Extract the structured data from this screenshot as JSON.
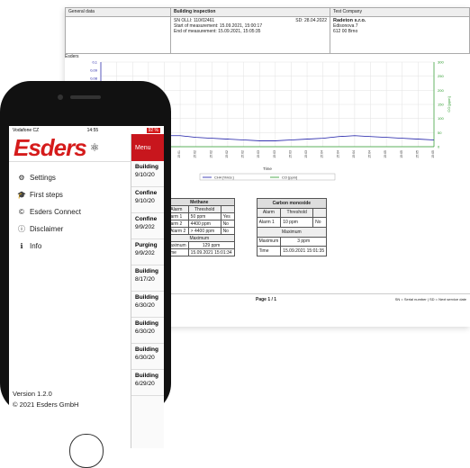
{
  "report": {
    "general_label": "General data",
    "title": "Building inspection",
    "sn": "SN OLLI: 110/02461",
    "sd": "SD: 28.04.2022",
    "start": "Start of measurement: 15.09.2021, 15:00:17",
    "end": "End of measurement: 15.09.2021, 15:05:35",
    "company_label": "Test Company",
    "company_name": "Radeton s.r.o.",
    "company_street": "Edisonova 7",
    "company_city": "612 00 Brno",
    "brand": "Esders",
    "time_label": "Time",
    "legend_ch4": "CH4 [%Vol.]",
    "legend_co": "CO [ppm]",
    "page": "Page 1 / 1",
    "footer_legend": "SN = Serial number  |  SD = Next service date",
    "methane": {
      "caption": "Methane",
      "h_alarm": "Alarm",
      "h_threshold": "Threshold",
      "a1": "Alarm 1",
      "a1v": "50 ppm",
      "a1s": "Yes",
      "a2": "Alarm 2",
      "a2v": "4400 ppm",
      "a2s": "No",
      "a3": "> Alarm 2",
      "a3v": "> 4400 ppm",
      "a3s": "No",
      "maxhdr": "Maximum",
      "max": "Maximum",
      "maxv": "129 ppm",
      "time": "Time",
      "timev": "15.09.2021 15:01:34"
    },
    "co": {
      "caption": "Carbon monoxide",
      "h_alarm": "Alarm",
      "h_threshold": "Threshold",
      "a1": "Alarm 1",
      "a1v": "10 ppm",
      "a1s": "No",
      "maxhdr": "Maximum",
      "max": "Maximum",
      "maxv": "3 ppm",
      "time": "Time",
      "timev": "15.09.2021 15:01:35"
    }
  },
  "chart_data": {
    "type": "line",
    "x": [
      "15:00",
      "15:00",
      "15:01",
      "15:01",
      "15:01",
      "15:01",
      "15:02",
      "15:02",
      "15:02",
      "15:02",
      "15:03",
      "15:03",
      "15:03",
      "15:03",
      "15:04",
      "15:04",
      "15:04",
      "15:04",
      "15:05",
      "15:05",
      "15:05",
      "15:05"
    ],
    "left_ticks": [
      "0,1",
      "0,09",
      "0,08",
      "0,07"
    ],
    "right_ticks": [
      "300",
      "250",
      "200",
      "150",
      "100",
      "50",
      "0"
    ],
    "right_label": "CO [ppm]",
    "xlabel": "Time",
    "ylim_left": [
      0,
      0.1
    ],
    "ylim_right": [
      0,
      300
    ],
    "series": [
      {
        "name": "CH4 [%Vol.]",
        "color": "#1a1aa6",
        "values": [
          0.011,
          0.011,
          0.011,
          0.012,
          0.013,
          0.013,
          0.011,
          0.01,
          0.009,
          0.008,
          0.007,
          0.007,
          0.008,
          0.009,
          0.01,
          0.012,
          0.013,
          0.012,
          0.011,
          0.01,
          0.009,
          0.008
        ]
      },
      {
        "name": "CO [ppm]",
        "color": "#2a9a2a",
        "values": [
          0,
          0,
          0,
          0,
          0,
          0,
          0,
          0,
          0,
          0,
          0,
          0,
          0,
          0,
          0,
          0,
          0,
          0,
          0,
          0,
          0,
          0
        ]
      }
    ],
    "grid": true,
    "legend": "bottom"
  },
  "phone": {
    "carrier": "Vodafone CZ",
    "time": "14:55",
    "battery": "92 %",
    "logo": "Esders",
    "menu_button": "Menu",
    "items": [
      {
        "label": "Settings",
        "icon": "⚙"
      },
      {
        "label": "First steps",
        "icon": "🎓"
      },
      {
        "label": "Esders Connect",
        "icon": "©"
      },
      {
        "label": "Disclaimer",
        "icon": "ⓘ"
      },
      {
        "label": "Info",
        "icon": "ℹ"
      }
    ],
    "version": "Version 1.2.0",
    "copyright": "© 2021 Esders GmbH",
    "jobs": [
      {
        "title": "Building",
        "date": "9/10/20"
      },
      {
        "title": "Confine",
        "date": "9/10/20"
      },
      {
        "title": "Confine",
        "date": "9/9/202"
      },
      {
        "title": "Purging",
        "date": "9/9/202"
      },
      {
        "title": "Building",
        "date": "8/17/20"
      },
      {
        "title": "Building",
        "date": "6/30/20"
      },
      {
        "title": "Building",
        "date": "6/30/20"
      },
      {
        "title": "Building",
        "date": "6/30/20"
      },
      {
        "title": "Building",
        "date": "6/29/20"
      }
    ]
  }
}
